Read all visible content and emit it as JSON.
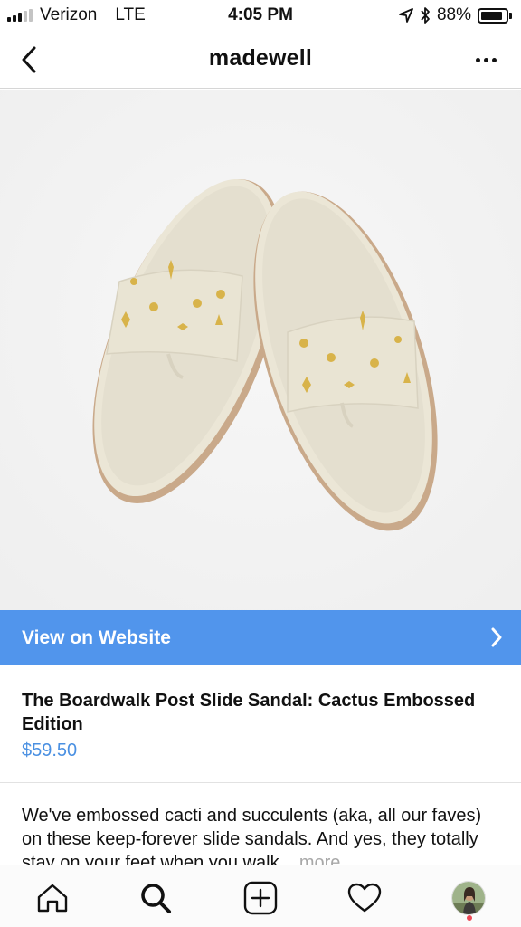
{
  "status_bar": {
    "carrier": "Verizon",
    "network": "LTE",
    "time": "4:05 PM",
    "battery_percent": "88%",
    "battery_level": 0.88,
    "signal_bars_filled": 3,
    "signal_bars_total": 5
  },
  "header": {
    "title": "madewell",
    "back_icon": "chevron-left-icon",
    "more_icon": "more-horizontal-icon"
  },
  "cta": {
    "label": "View on Website",
    "background": "#5195ec",
    "icon": "chevron-right-icon"
  },
  "product": {
    "name": "The Boardwalk Post Slide Sandal: Cactus Embossed Edition",
    "price": "$59.50",
    "price_color": "#4a90e2",
    "description": "We've embossed cacti and succulents (aka, all our faves) on these keep-forever slide sandals. And yes, they totally stay on your feet when you walk...",
    "more_label": "more"
  },
  "tab_bar": {
    "items": [
      "home-icon",
      "search-icon",
      "add-post-icon",
      "heart-icon",
      "profile-avatar"
    ]
  }
}
